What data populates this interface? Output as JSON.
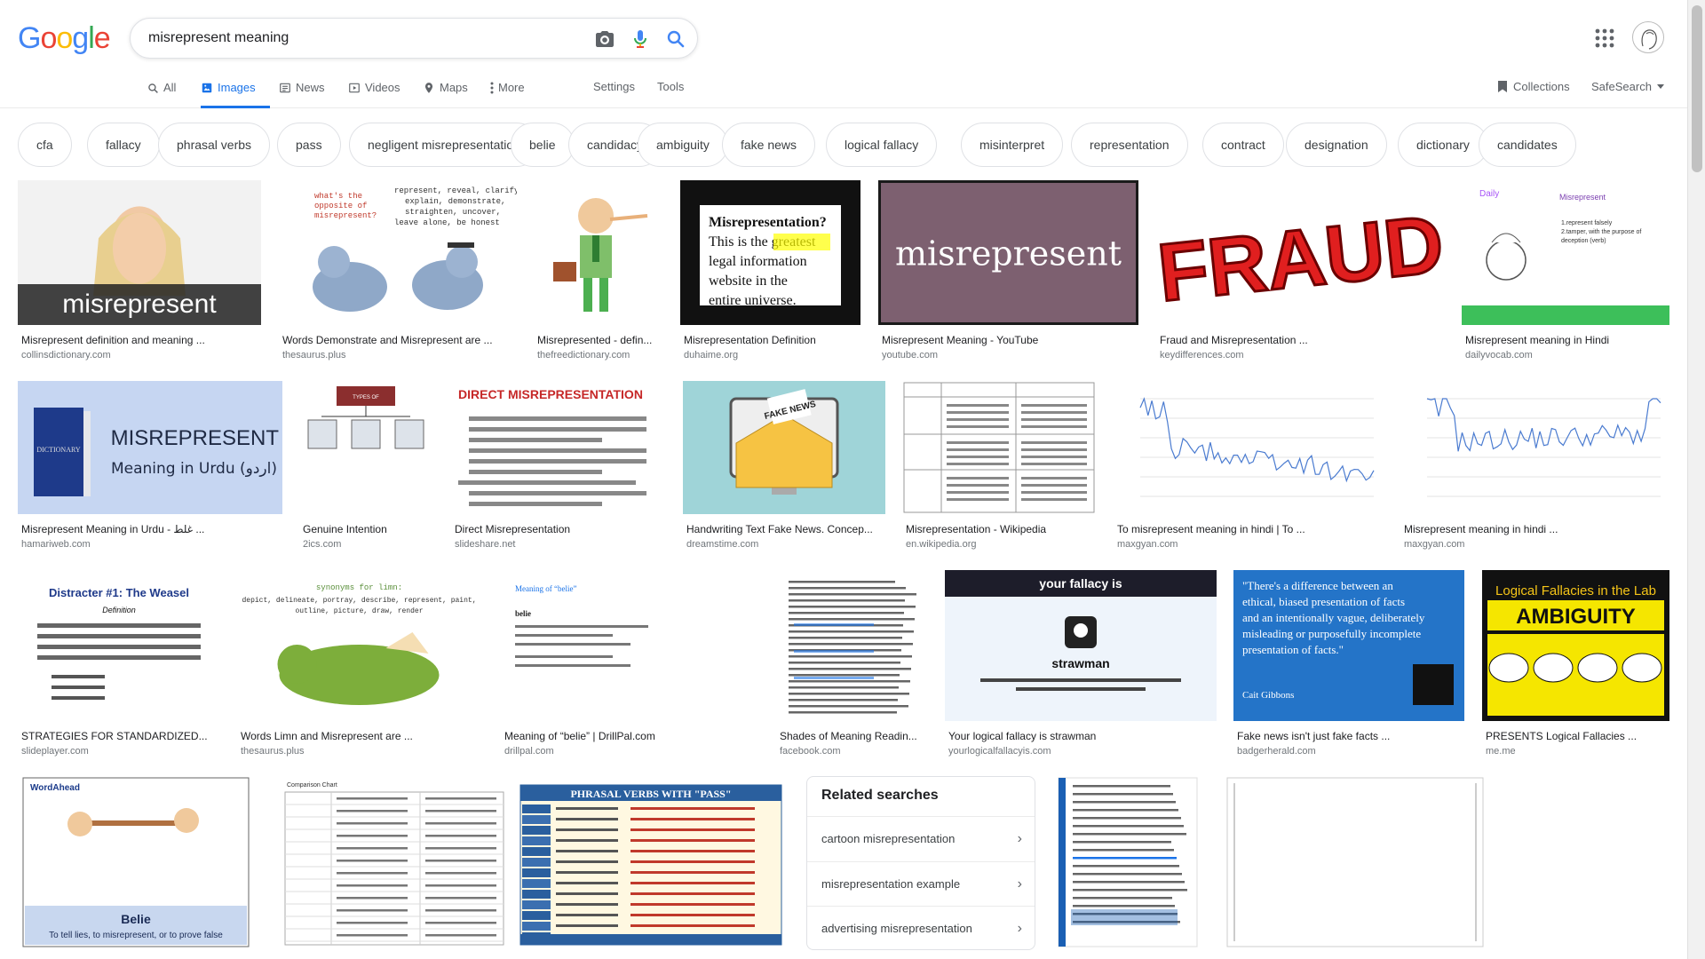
{
  "logo": {
    "letters": [
      "G",
      "o",
      "o",
      "g",
      "l",
      "e"
    ],
    "colors": [
      "#4285F4",
      "#EA4335",
      "#FBBC05",
      "#4285F4",
      "#34A853",
      "#EA4335"
    ]
  },
  "search": {
    "query": "misrepresent meaning"
  },
  "tabs": [
    {
      "label": "All",
      "icon": "search-icon"
    },
    {
      "label": "Images",
      "icon": "image-icon",
      "active": true
    },
    {
      "label": "News",
      "icon": "news-icon"
    },
    {
      "label": "Videos",
      "icon": "video-icon"
    },
    {
      "label": "Maps",
      "icon": "map-pin-icon"
    },
    {
      "label": "More",
      "icon": "more-vert-icon"
    }
  ],
  "tools": {
    "settings": "Settings",
    "tools": "Tools",
    "collections": "Collections",
    "safesearch": "SafeSearch"
  },
  "chips": [
    "cfa",
    "fallacy",
    "phrasal verbs",
    "pass",
    "negligent misrepresentation",
    "belie",
    "candidacy",
    "ambiguity",
    "fake news",
    "logical fallacy",
    "misinterpret",
    "representation",
    "contract",
    "designation",
    "dictionary",
    "candidates"
  ],
  "results": [
    {
      "caption": "Misrepresent definition and meaning ...",
      "source": "collinsdictionary.com",
      "overlay": "misrepresent"
    },
    {
      "caption": "Words Demonstrate and Misrepresent are ...",
      "source": "thesaurus.plus",
      "overlay": "represent, reveal, clarify, explain, demonstrate, straighten, uncover, leave alone, be honest",
      "overlay2": "what's the opposite of misrepresent?"
    },
    {
      "caption": "Misrepresented - defin...",
      "source": "thefreedictionary.com"
    },
    {
      "caption": "Misrepresentation Definition",
      "source": "duhaime.org",
      "overlay": "Misrepresentation?",
      "overlay2": "This is the greatest legal information website in the entire universe."
    },
    {
      "caption": "Misrepresent Meaning - YouTube",
      "source": "youtube.com",
      "overlay": "misrepresent"
    },
    {
      "caption": "Fraud and Misrepresentation ...",
      "source": "keydifferences.com",
      "overlay": "FRAUD"
    },
    {
      "caption": "Misrepresent meaning in Hindi",
      "source": "dailyvocab.com"
    },
    {
      "caption": "Misrepresent Meaning in Urdu - غلط ...",
      "source": "hamariweb.com",
      "overlay": "MISREPRESENT",
      "overlay2": "Meaning in Urdu (اردو)"
    },
    {
      "caption": "Genuine Intention",
      "source": "2ics.com",
      "overlay": "TYPES OF MISREPRESENTATION"
    },
    {
      "caption": "Direct Misrepresentation",
      "source": "slideshare.net",
      "overlay": "DIRECT MISREPRESENTATION"
    },
    {
      "caption": "Handwriting Text Fake News. Concep...",
      "source": "dreamstime.com",
      "overlay": "FAKE NEWS"
    },
    {
      "caption": "Misrepresentation - Wikipedia",
      "source": "en.wikipedia.org"
    },
    {
      "caption": "To misrepresent meaning in hindi | To ...",
      "source": "maxgyan.com"
    },
    {
      "caption": "Misrepresent meaning in hindi ...",
      "source": "maxgyan.com"
    },
    {
      "caption": "STRATEGIES FOR STANDARDIZED...",
      "source": "slideplayer.com",
      "overlay": "Distracter #1: The Weasel"
    },
    {
      "caption": "Words Limn and Misrepresent are ...",
      "source": "thesaurus.plus",
      "overlay": "synonyms for limn:",
      "overlay2": "depict, delineate, portray, describe, represent, paint, outline, picture, draw, render"
    },
    {
      "caption": "Meaning of “belie” | DrillPal.com",
      "source": "drillpal.com",
      "overlay": "Meaning of “belie”"
    },
    {
      "caption": "Shades of Meaning Readin...",
      "source": "facebook.com"
    },
    {
      "caption": "Your logical fallacy is strawman",
      "source": "yourlogicalfallacyis.com",
      "overlay": "your fallacy is",
      "overlay2": "strawman"
    },
    {
      "caption": "Fake news isn't just fake facts ...",
      "source": "badgerherald.com",
      "overlay": "\"There's a difference between an ethical, biased presentation of facts and an intentionally vague, deliberately misleading or purposefully incomplete presentation of facts.\"",
      "overlay2": "Cait Gibbons"
    },
    {
      "caption": "PRESENTS Logical Fallacies ...",
      "source": "me.me",
      "overlay": "Logical Fallacies in the Lab",
      "overlay2": "AMBIGUITY"
    },
    {
      "overlay": "Belie",
      "overlay2": "To tell lies, to misrepresent, or to prove false"
    },
    {
      "overlay": "Comparison Chart"
    },
    {
      "overlay": "PHRASAL VERBS WITH \"PASS\""
    },
    {},
    {
      "overlay": "\"Free speech and freedom of the press are basic rights enshrined in the German constitution. Article 5 of the \"Grundgesetz\" says, \"Every person shall have the right freely to express and disseminate his opinions in speech, writing and pictures, and to inform himself from generally accessible sources.\"",
      "overlay2": "Apr 19, 2016"
    },
    {}
  ],
  "related": {
    "title": "Related searches",
    "items": [
      "cartoon misrepresentation",
      "misrepresentation example",
      "advertising misrepresentation"
    ]
  }
}
